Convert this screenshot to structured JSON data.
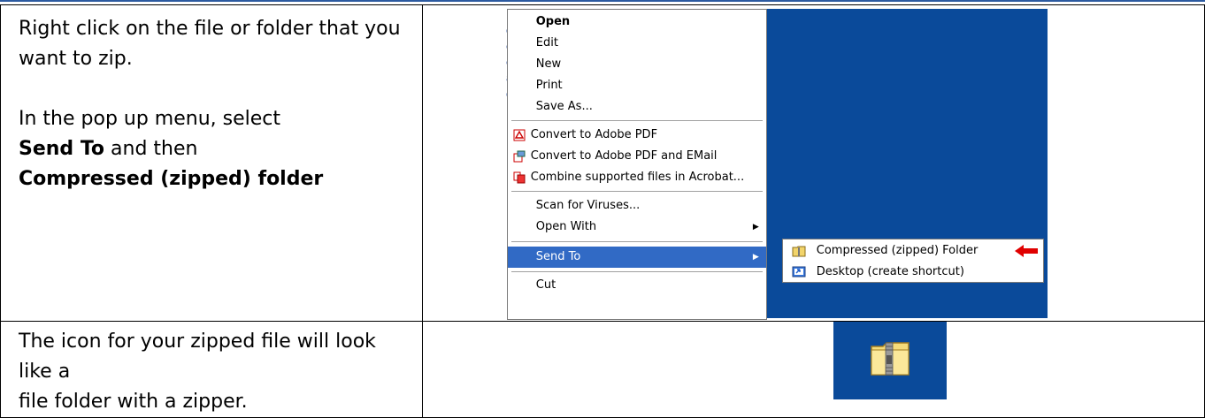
{
  "row1": {
    "line1": "Right click on the file or folder that you",
    "line2": "want to zip.",
    "line3": "In the pop up menu, select",
    "line4_bold": "Send To",
    "line4_rest": " and then",
    "line5_bold": "Compressed (zipped) folder"
  },
  "row2": {
    "line1": "The icon for your zipped file will look like a",
    "line2": "file folder with a zipper."
  },
  "context_menu": {
    "items": [
      {
        "label": "Open"
      },
      {
        "label": "Edit"
      },
      {
        "label": "New"
      },
      {
        "label": "Print"
      },
      {
        "label": "Save As..."
      },
      {
        "label": "Convert to Adobe PDF",
        "icon": "pdf-icon"
      },
      {
        "label": "Convert to Adobe PDF and EMail",
        "icon": "pdf-email-icon"
      },
      {
        "label": "Combine supported files in Acrobat...",
        "icon": "acrobat-combine-icon"
      },
      {
        "label": "Scan for Viruses..."
      },
      {
        "label": "Open With"
      },
      {
        "label": "Send To"
      },
      {
        "label": "Cut"
      }
    ],
    "desktop_fragments": [
      "du",
      "ec",
      "e",
      "ar",
      "da"
    ]
  },
  "submenu": {
    "items": [
      {
        "label": "Compressed (zipped) Folder",
        "icon": "zip-folder-icon"
      },
      {
        "label": "Desktop (create shortcut)",
        "icon": "desktop-shortcut-icon"
      }
    ]
  },
  "colors": {
    "desktop_blue": "#0a4a9a",
    "highlight": "#316ac5",
    "arrow_red": "#e00000"
  }
}
